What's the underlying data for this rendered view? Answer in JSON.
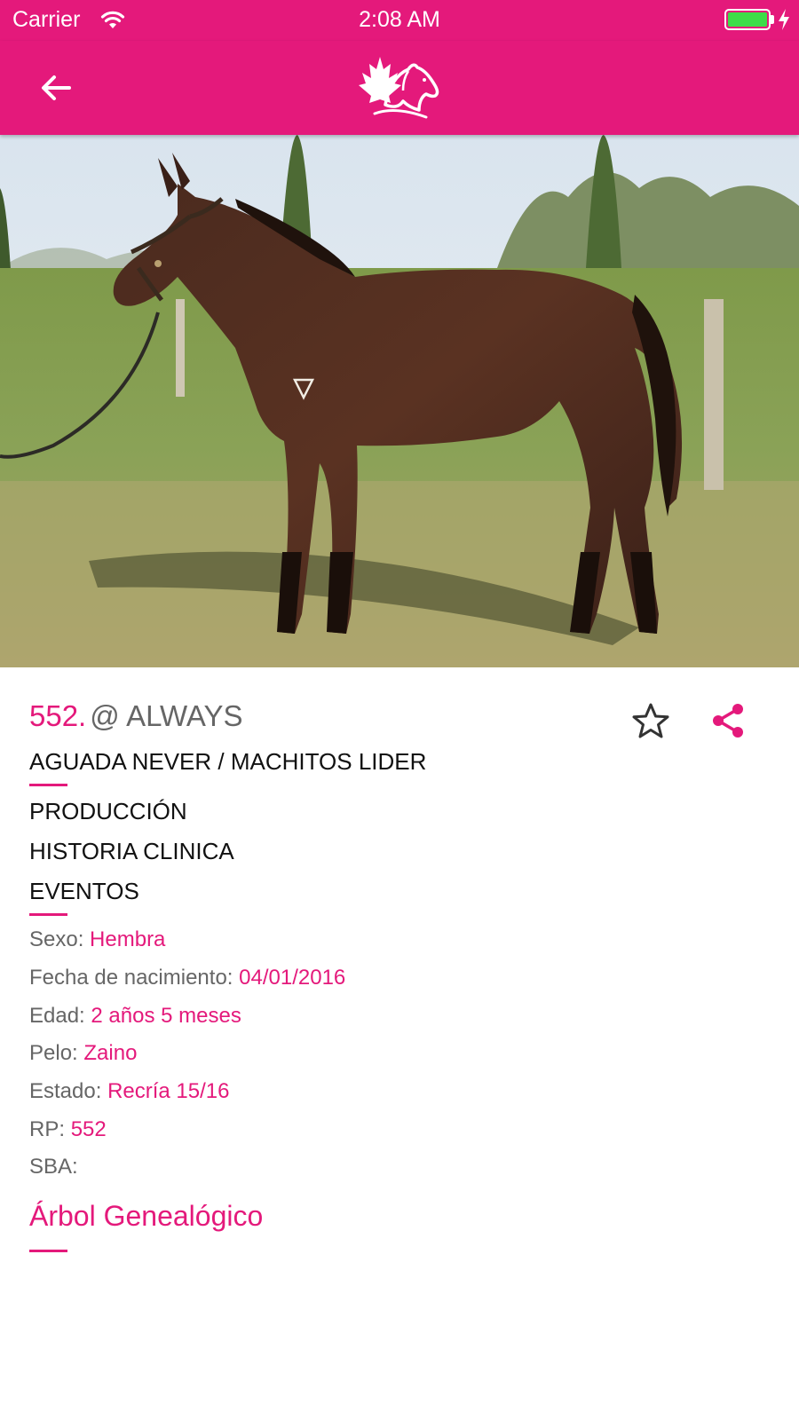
{
  "status_bar": {
    "carrier": "Carrier",
    "time": "2:08 AM",
    "wifi_icon": "wifi-icon",
    "battery_icon": "battery-icon",
    "charging_icon": "bolt-icon"
  },
  "app_bar": {
    "back_icon": "arrow-left-icon",
    "logo": "maple-leaf-horse-logo",
    "background_color": "#e4197b"
  },
  "hero": {
    "image": "horse-photo"
  },
  "horse": {
    "number": "552.",
    "name": "@ ALWAYS",
    "parents": "AGUADA NEVER / MACHITOS LIDER",
    "favorite_icon": "star-outline-icon",
    "share_icon": "share-icon"
  },
  "links": {
    "produccion": "PRODUCCIÓN",
    "historia": "HISTORIA CLINICA",
    "eventos": "EVENTOS"
  },
  "details": {
    "sexo_label": "Sexo:",
    "sexo_value": "Hembra",
    "fecha_label": "Fecha de nacimiento:",
    "fecha_value": "04/01/2016",
    "edad_label": "Edad:",
    "edad_value": "2 años 5 meses",
    "pelo_label": "Pelo:",
    "pelo_value": "Zaino",
    "estado_label": "Estado:",
    "estado_value": "Recría 15/16",
    "rp_label": "RP:",
    "rp_value": "552",
    "sba_label": "SBA:",
    "sba_value": ""
  },
  "pedigree": {
    "title": "Árbol Genealógico"
  },
  "colors": {
    "accent": "#e4197b",
    "label": "#666666",
    "text": "#111111"
  }
}
